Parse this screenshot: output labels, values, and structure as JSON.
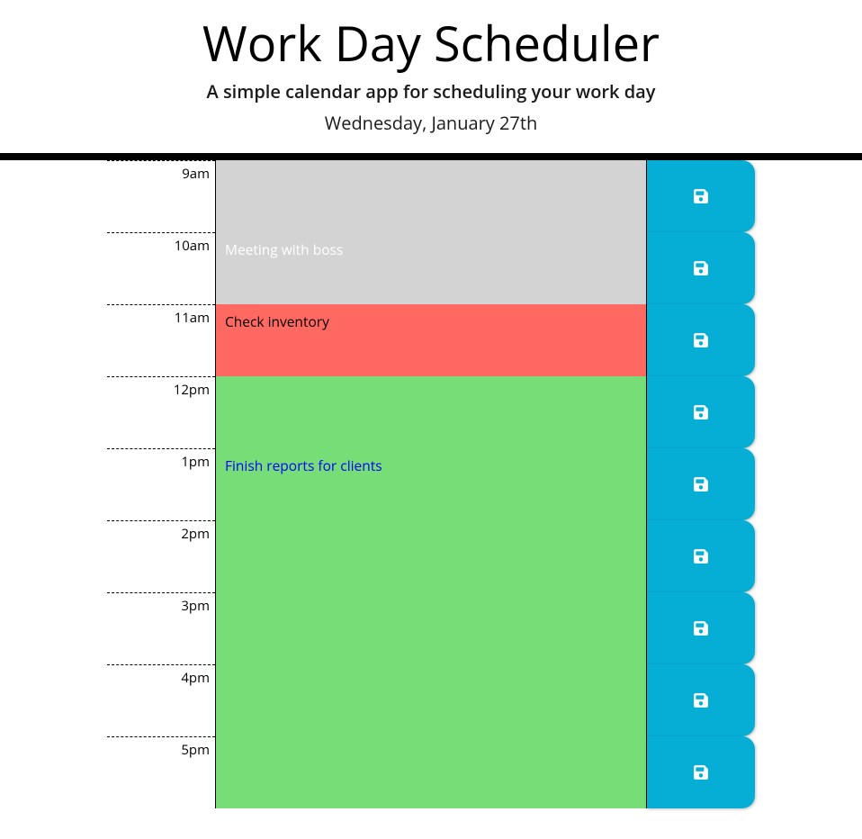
{
  "header": {
    "title": "Work Day Scheduler",
    "subtitle": "A simple calendar app for scheduling your work day",
    "currentDay": "Wednesday, January 27th"
  },
  "rows": [
    {
      "hour": "9am",
      "text": "",
      "state": "past"
    },
    {
      "hour": "10am",
      "text": "Meeting with boss",
      "state": "past"
    },
    {
      "hour": "11am",
      "text": "Check inventory",
      "state": "present"
    },
    {
      "hour": "12pm",
      "text": "",
      "state": "future"
    },
    {
      "hour": "1pm",
      "text": "Finish reports for clients",
      "state": "future"
    },
    {
      "hour": "2pm",
      "text": "",
      "state": "future"
    },
    {
      "hour": "3pm",
      "text": "",
      "state": "future"
    },
    {
      "hour": "4pm",
      "text": "",
      "state": "future"
    },
    {
      "hour": "5pm",
      "text": "",
      "state": "future"
    }
  ]
}
